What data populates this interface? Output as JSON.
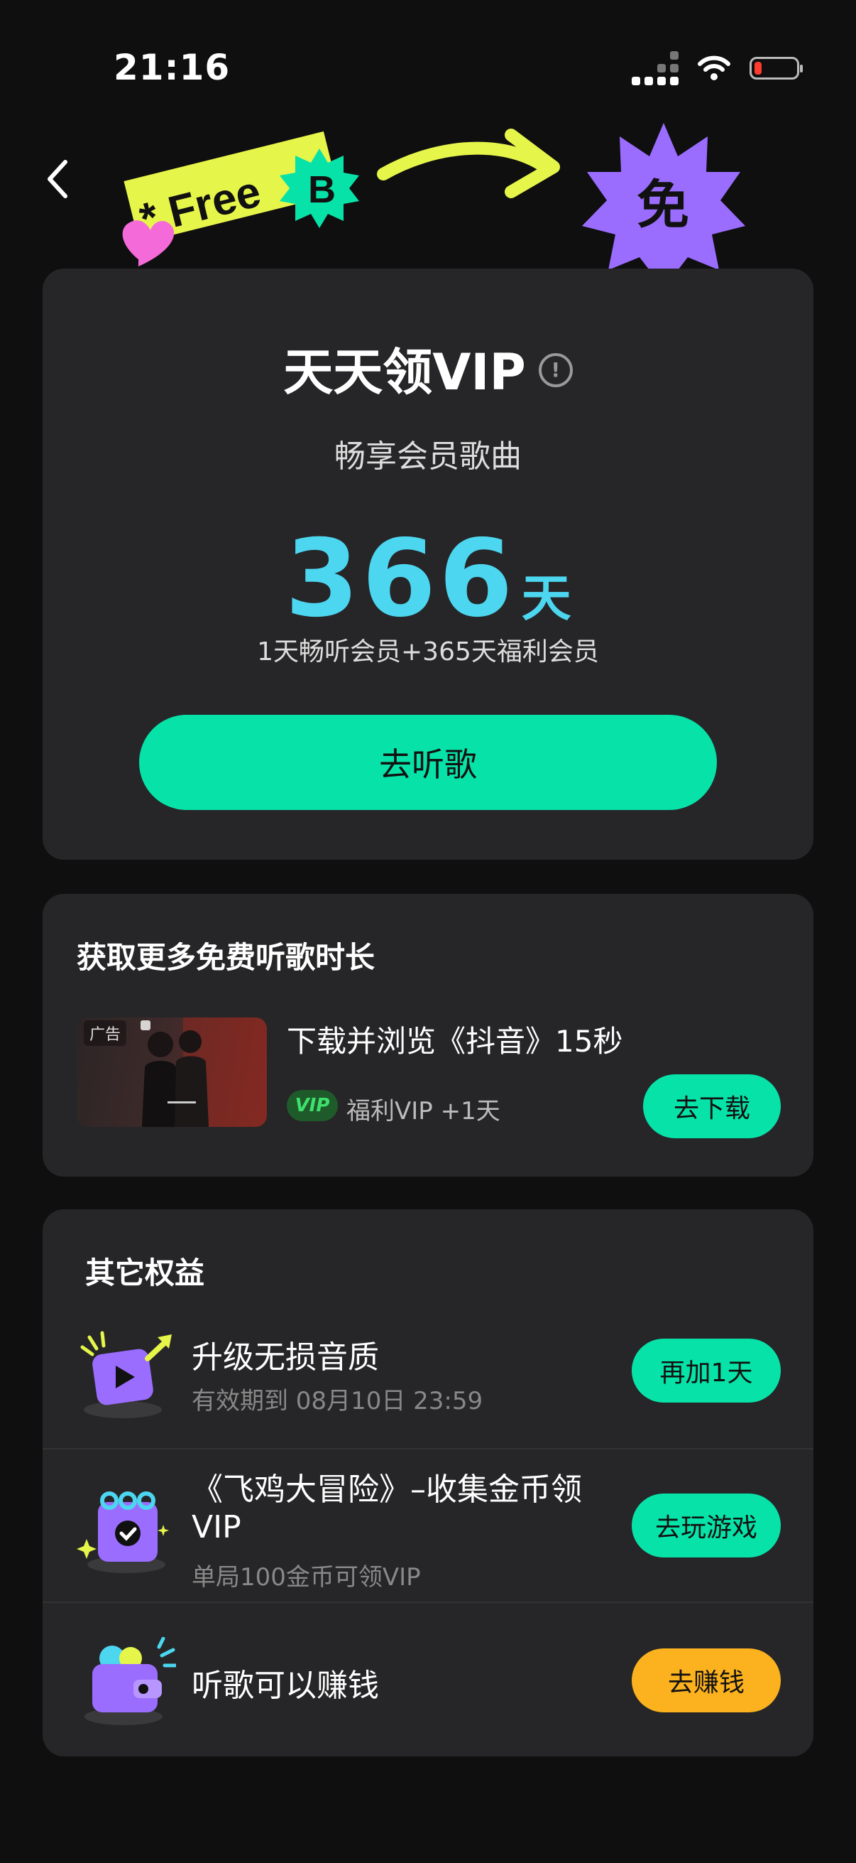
{
  "status_bar": {
    "time": "21:16"
  },
  "banner": {
    "free_text": "* Free",
    "badge_letter": "B",
    "burst_char": "免"
  },
  "main_card": {
    "title": "天天领VIP",
    "info_icon": "!",
    "subtitle": "畅享会员歌曲",
    "days_number": "366",
    "days_unit": "天",
    "days_detail": "1天畅听会员+365天福利会员",
    "cta_label": "去听歌"
  },
  "more_time": {
    "title": "获取更多免费听歌时长",
    "ad": {
      "tag": "广告",
      "title": "下载并浏览《抖音》15秒",
      "vip_badge": "VIP",
      "reward": "福利VIP +1天",
      "button": "去下载"
    }
  },
  "other_benefits": {
    "title": "其它权益",
    "items": [
      {
        "title": "升级无损音质",
        "subtitle": "有效期到 08月10日 23:59",
        "button": "再加1天",
        "icon": "play-box-icon"
      },
      {
        "title_line1": "《飞鸡大冒险》–收集金币领",
        "title_line2": "VIP",
        "subtitle": "单局100金币可领VIP",
        "button": "去玩游戏",
        "icon": "calendar-check-icon"
      },
      {
        "title": "听歌可以赚钱",
        "subtitle": "",
        "button": "去赚钱",
        "icon": "wallet-icon"
      }
    ]
  },
  "colors": {
    "accent_green": "#07e3a8",
    "accent_cyan": "#4cd6f0",
    "accent_orange": "#fbb21e",
    "card_bg": "#262628"
  }
}
